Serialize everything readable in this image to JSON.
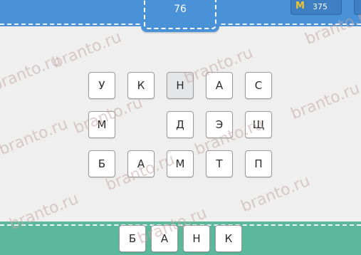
{
  "header": {
    "level": "76",
    "coin_icon": "М",
    "coins": "375"
  },
  "grid": [
    {
      "letter": "У"
    },
    {
      "letter": "К"
    },
    {
      "letter": "Н"
    },
    {
      "letter": "А"
    },
    {
      "letter": "С"
    },
    {
      "letter": "М"
    },
    {
      "letter": "Д"
    },
    {
      "letter": "Э"
    },
    {
      "letter": "Щ"
    },
    {
      "letter": "Б"
    },
    {
      "letter": "А"
    },
    {
      "letter": "М"
    },
    {
      "letter": "Т"
    },
    {
      "letter": "П"
    }
  ],
  "answer": [
    {
      "letter": "Б"
    },
    {
      "letter": "А"
    },
    {
      "letter": "Н"
    },
    {
      "letter": "К"
    }
  ],
  "watermark": "branto.ru",
  "colors": {
    "header_blue": "#4a92d8",
    "footer_green": "#5bb89a",
    "background": "#efefef"
  }
}
